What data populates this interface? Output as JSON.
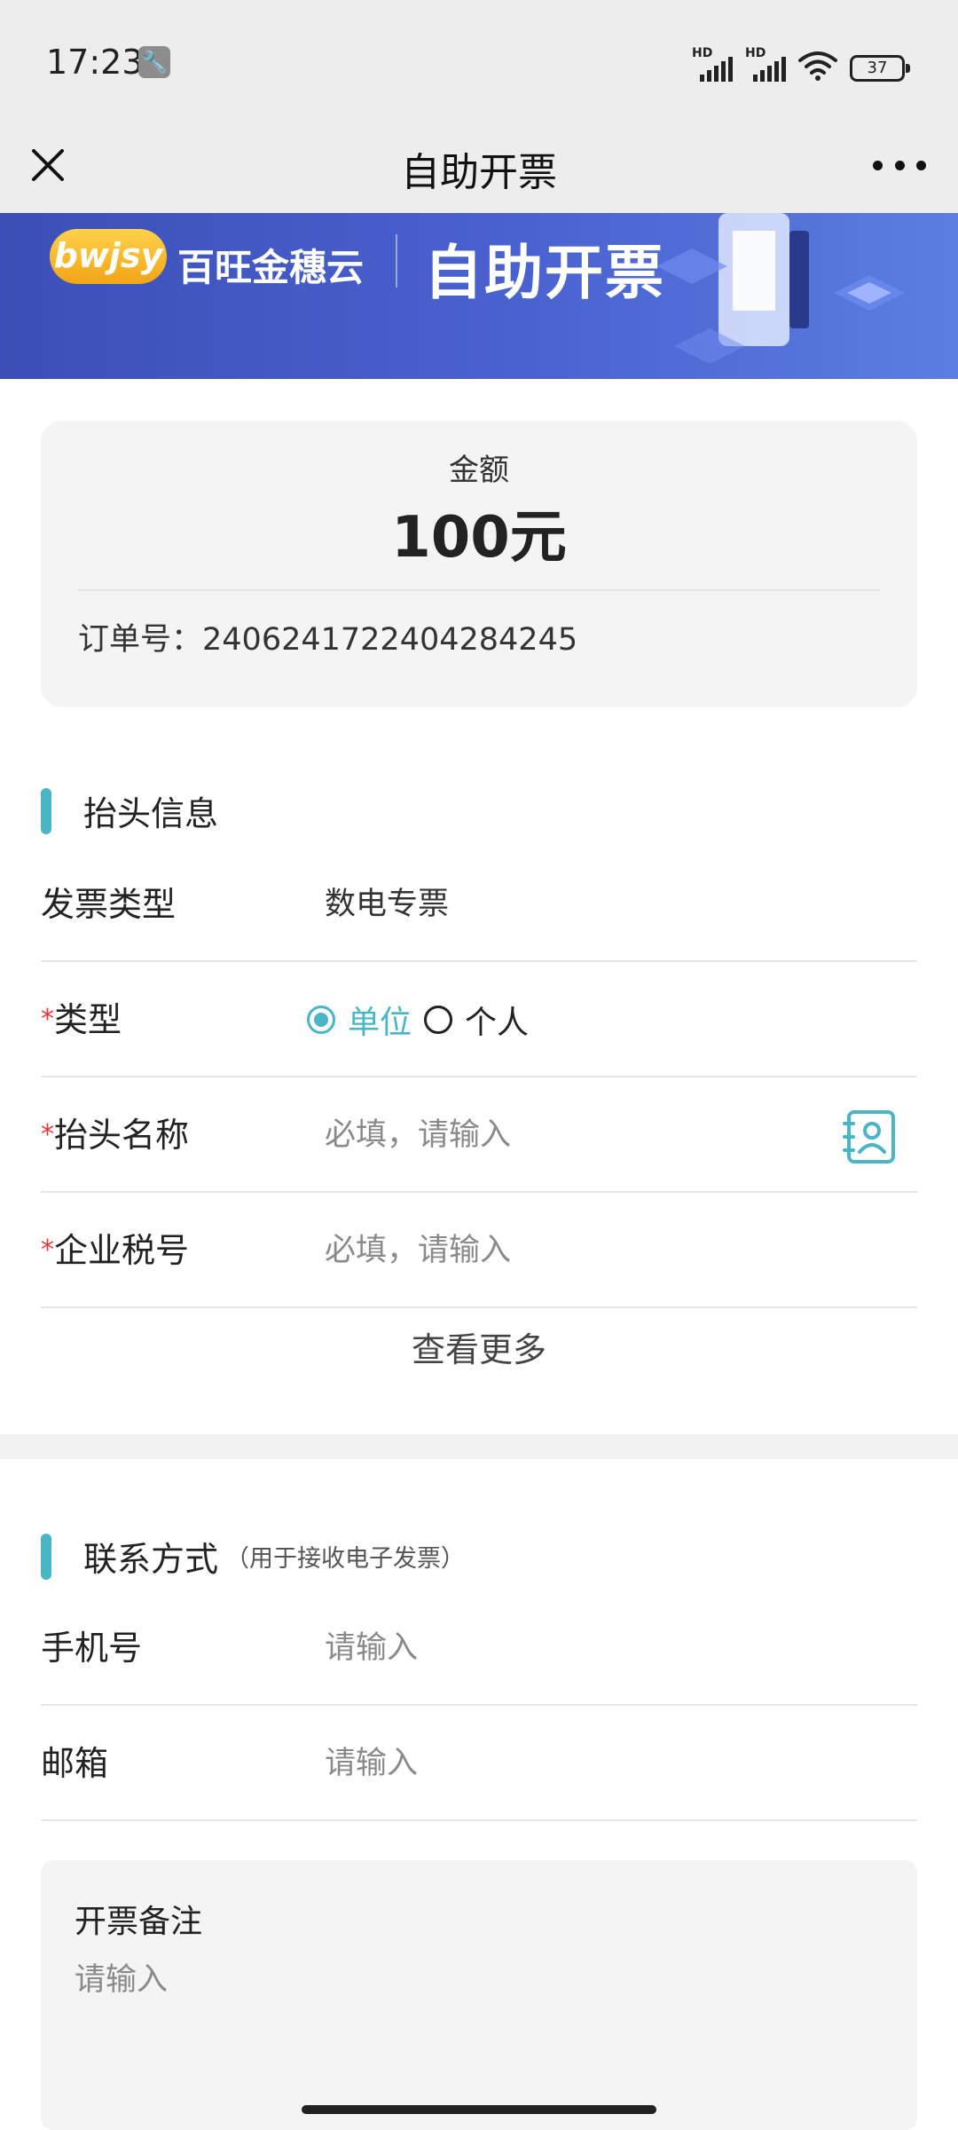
{
  "status_bar": {
    "time": "17:23",
    "wrench_icon": "wrench-icon",
    "signal_labels": [
      "HD",
      "HD"
    ],
    "battery": "37"
  },
  "nav": {
    "title": "自助开票",
    "close_icon": "close-icon",
    "more_icon": "more-dots-icon"
  },
  "banner": {
    "logo_text": "bwjsy",
    "brand": "百旺金穗云",
    "title": "自助开票",
    "colors": {
      "start": "#3c4fb6",
      "end": "#5b7ee0"
    }
  },
  "amount_card": {
    "label": "金额",
    "value": "100元",
    "order_label": "订单号：",
    "order_no": "2406241722404284245"
  },
  "header_section": {
    "title": "抬头信息",
    "invoice_type_label": "发票类型",
    "invoice_type_value": "数电专票",
    "type_label": "类型",
    "type_options": [
      {
        "label": "单位",
        "checked": true
      },
      {
        "label": "个人",
        "checked": false
      }
    ],
    "title_name_label": "抬头名称",
    "title_name_placeholder": "必填，请输入",
    "tax_no_label": "企业税号",
    "tax_no_placeholder": "必填，请输入",
    "see_more": "查看更多",
    "required_mark": "*"
  },
  "contact_section": {
    "title": "联系方式",
    "subtitle": "（用于接收电子发票）",
    "phone_label": "手机号",
    "phone_placeholder": "请输入",
    "email_label": "邮箱",
    "email_placeholder": "请输入"
  },
  "remark": {
    "title": "开票备注",
    "placeholder": "请输入"
  },
  "accent_color": "#4ab5c4",
  "required_color": "#e53935"
}
